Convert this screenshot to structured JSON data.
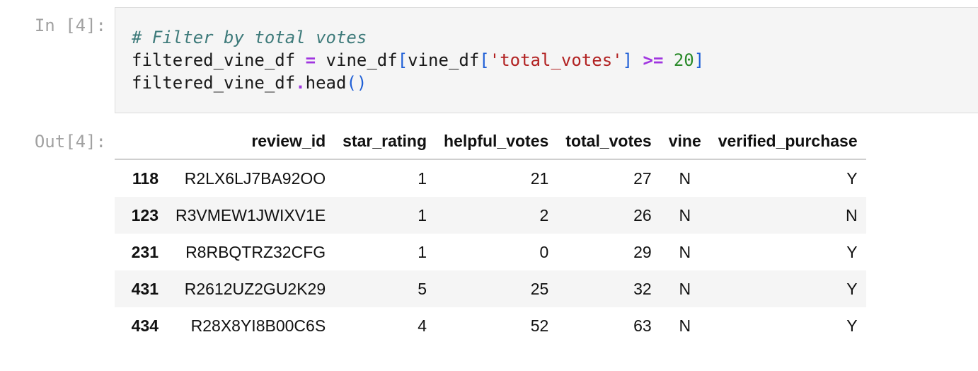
{
  "input_cell": {
    "prompt": "In [4]:",
    "code": {
      "line1_comment": "# Filter by total votes",
      "line2": {
        "var": "filtered_vine_df ",
        "assign": "=",
        "rhs_name": " vine_df",
        "open_bracket": "[",
        "inner_name": "vine_df",
        "open_bracket2": "[",
        "key": "'total_votes'",
        "close_bracket2": "]",
        "space1": " ",
        "cmp": ">=",
        "space2": " ",
        "num": "20",
        "close_bracket": "]"
      },
      "line3": {
        "var": "filtered_vine_df",
        "dot": ".",
        "method": "head",
        "parens": "()"
      }
    }
  },
  "output_cell": {
    "prompt": "Out[4]:",
    "table": {
      "columns": [
        "",
        "review_id",
        "star_rating",
        "helpful_votes",
        "total_votes",
        "vine",
        "verified_purchase"
      ],
      "rows": [
        {
          "index": "118",
          "review_id": "R2LX6LJ7BA92OO",
          "star_rating": "1",
          "helpful_votes": "21",
          "total_votes": "27",
          "vine": "N",
          "verified_purchase": "Y"
        },
        {
          "index": "123",
          "review_id": "R3VMEW1JWIXV1E",
          "star_rating": "1",
          "helpful_votes": "2",
          "total_votes": "26",
          "vine": "N",
          "verified_purchase": "N"
        },
        {
          "index": "231",
          "review_id": "R8RBQTRZ32CFG",
          "star_rating": "1",
          "helpful_votes": "0",
          "total_votes": "29",
          "vine": "N",
          "verified_purchase": "Y"
        },
        {
          "index": "431",
          "review_id": "R2612UZ2GU2K29",
          "star_rating": "5",
          "helpful_votes": "25",
          "total_votes": "32",
          "vine": "N",
          "verified_purchase": "Y"
        },
        {
          "index": "434",
          "review_id": "R28X8YI8B00C6S",
          "star_rating": "4",
          "helpful_votes": "52",
          "total_votes": "63",
          "vine": "N",
          "verified_purchase": "Y"
        }
      ]
    }
  }
}
